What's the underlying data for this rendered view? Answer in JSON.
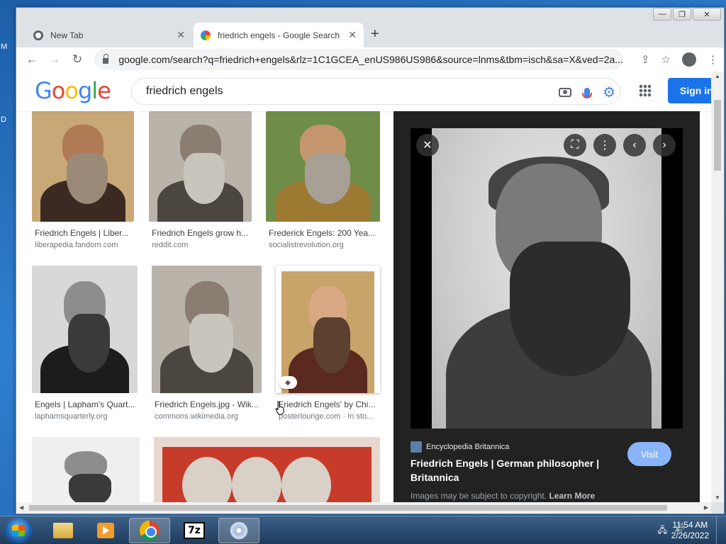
{
  "desktop": {
    "frag_m": "M",
    "frag_d": "D"
  },
  "browser": {
    "tabs": [
      {
        "title": "New Tab",
        "close": "✕"
      },
      {
        "title": "friedrich engels - Google Search",
        "close": "✕"
      }
    ],
    "new_tab": "+",
    "caption": {
      "minimize": "—",
      "maximize": "❐",
      "close": "✕"
    },
    "nav": {
      "back": "←",
      "forward": "→",
      "reload": "↻"
    },
    "url": "google.com/search?q=friedrich+engels&rlz=1C1GCEA_enUS986US986&source=lnms&tbm=isch&sa=X&ved=2a...",
    "toolbar_icons": {
      "share": "⇪",
      "bookmark": "☆",
      "menu": "⋮"
    }
  },
  "google": {
    "logo": [
      "G",
      "o",
      "o",
      "g",
      "l",
      "e"
    ],
    "query": "friedrich engels",
    "signin": "Sign in",
    "settings_glyph": "⚙"
  },
  "results": [
    {
      "title": "Friedrich Engels | Liber...",
      "source": "liberapedia.fandom.com"
    },
    {
      "title": "Friedrich Engels grow h...",
      "source": "reddit.com"
    },
    {
      "title": "Frederick Engels: 200 Yea...",
      "source": "socialistrevolution.org"
    },
    {
      "title": "Engels | Lapham's Quart...",
      "source": "laphamsquarterly.org"
    },
    {
      "title": "Friedrich Engels.jpg - Wik...",
      "source": "commons.wikimedia.org"
    },
    {
      "title": "Friedrich Engels' by Chi...",
      "source": "posterlounge.com · In sto..."
    }
  ],
  "preview": {
    "source": "Encyclopedia Britannica",
    "title": "Friedrich Engels | German philosopher | Britannica",
    "visit": "Visit",
    "copyright": "Images may be subject to copyright.",
    "learn_more": "Learn More",
    "buttons": {
      "close": "✕",
      "lens": "⛶",
      "more": "⋮",
      "prev": "‹",
      "next": "›"
    }
  },
  "taskbar": {
    "time": "11:54 AM",
    "date": "2/26/2022",
    "app_7z": "7z",
    "tray_network": "🖧",
    "tray_volume": "🔊"
  }
}
